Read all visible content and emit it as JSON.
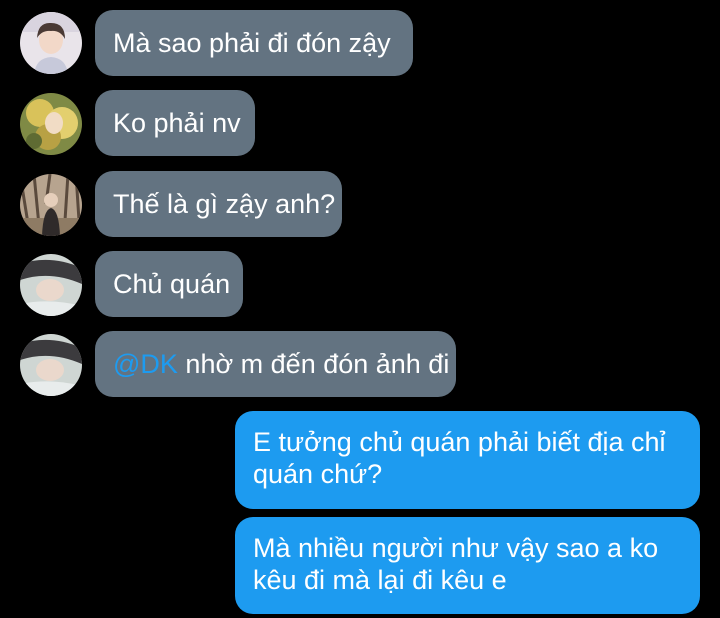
{
  "messages": [
    {
      "sender": "other",
      "avatar": "avatar-boy-portrait",
      "text": "Mà sao phải đi đón zậy"
    },
    {
      "sender": "other",
      "avatar": "avatar-yellow-flowers",
      "text": "Ko phải nv"
    },
    {
      "sender": "other",
      "avatar": "avatar-forest-person",
      "text": "Thế là gì zậy anh?"
    },
    {
      "sender": "other",
      "avatar": "avatar-lying-person",
      "text": "Chủ quán"
    },
    {
      "sender": "other",
      "avatar": "avatar-lying-person",
      "mention": "@DK",
      "text": " nhờ m đến đón ảnh đi"
    },
    {
      "sender": "me",
      "lines": [
        "E tưởng chủ quán phải biết địa chỉ",
        "quán chứ?"
      ]
    },
    {
      "sender": "me",
      "lines": [
        "Mà nhiều người như vậy sao a ko",
        "kêu đi mà lại đi kêu e"
      ]
    }
  ],
  "colors": {
    "background": "#000000",
    "incoming_bubble": "#637381",
    "outgoing_bubble": "#1d9bf0",
    "mention": "#1d9bf0",
    "text": "#ffffff"
  }
}
